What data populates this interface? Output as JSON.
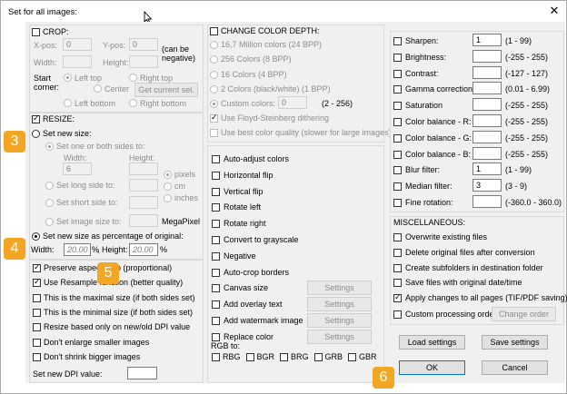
{
  "window": {
    "title": "Set for all images:",
    "close_glyph": "✕"
  },
  "crop": {
    "header": "CROP:",
    "xpos_label": "X-pos:",
    "xpos_value": "0",
    "ypos_label": "Y-pos:",
    "ypos_value": "0",
    "can_be_negative": "(can be\nnegative)",
    "width_label": "Width:",
    "width_value": "",
    "height_label": "Height:",
    "height_value": "",
    "start_corner": "Start\ncorner:",
    "left_top": "Left top",
    "right_top": "Right top",
    "center": "Center",
    "get_current_sel": "Get current sel.",
    "left_bottom": "Left bottom",
    "right_bottom": "Right bottom"
  },
  "resize": {
    "header": "RESIZE:",
    "set_new_size": "Set new size:",
    "set_one_or_both": "Set one or both sides to:",
    "width_label": "Width:",
    "height_label": "Height:",
    "width_value": "6",
    "height_value": "",
    "pixels": "pixels",
    "cm": "cm",
    "inches": "inches",
    "long_side": "Set long side to:",
    "short_side": "Set short side to:",
    "image_size": "Set image size to:",
    "megapixel": "MegaPixel",
    "percentage": "Set new size as percentage of original:",
    "pct_width_label": "Width:",
    "pct_width_value": "20.00",
    "pct_symbol": "%",
    "pct_height_label": ", Height:",
    "pct_height_value": "20.00"
  },
  "options_left": [
    {
      "label": "Preserve aspect ratio (proportional)",
      "checked": true
    },
    {
      "label": "Use Resample function (better quality)",
      "checked": true
    },
    {
      "label": "This is the maximal size (if both sides set)",
      "checked": false
    },
    {
      "label": "This is the minimal size (if both sides set)",
      "checked": false
    },
    {
      "label": "Resize based only on new/old DPI value",
      "checked": false
    },
    {
      "label": "Don't enlarge smaller images",
      "checked": false
    },
    {
      "label": "Don't shrink bigger images",
      "checked": false
    }
  ],
  "dpi": {
    "label": "Set new DPI value:",
    "value": ""
  },
  "color_depth": {
    "header": "CHANGE COLOR DEPTH:",
    "options": [
      "16,7 Million colors (24 BPP)",
      "256 Colors (8 BPP)",
      "16 Colors (4 BPP)",
      "2 Colors (black/white) (1 BPP)"
    ],
    "custom_label": "Custom colors:",
    "custom_value": "0",
    "custom_range": "(2 - 256)",
    "floyd": "Use Floyd-Steinberg dithering",
    "best_quality": "Use best color quality (slower for large images)"
  },
  "transforms": [
    {
      "label": "Auto-adjust colors",
      "settings": false
    },
    {
      "label": "Horizontal flip",
      "settings": false
    },
    {
      "label": "Vertical flip",
      "settings": false
    },
    {
      "label": "Rotate left",
      "settings": false
    },
    {
      "label": "Rotate right",
      "settings": false
    },
    {
      "label": "Convert to grayscale",
      "settings": false
    },
    {
      "label": "Negative",
      "settings": false
    },
    {
      "label": "Auto-crop borders",
      "settings": false
    },
    {
      "label": "Canvas size",
      "settings": true
    },
    {
      "label": "Add overlay text",
      "settings": true
    },
    {
      "label": "Add watermark image",
      "settings": true
    },
    {
      "label": "Replace color",
      "settings": true
    }
  ],
  "settings_label": "Settings",
  "rgb": {
    "label": "RGB to:",
    "options": [
      "RBG",
      "BGR",
      "BRG",
      "GRB",
      "GBR"
    ]
  },
  "adjustments": [
    {
      "label": "Sharpen:",
      "value": "1",
      "range": "(1 - 99)"
    },
    {
      "label": "Brightness:",
      "value": "",
      "range": "(-255 - 255)"
    },
    {
      "label": "Contrast:",
      "value": "",
      "range": "(-127 - 127)"
    },
    {
      "label": "Gamma correction:",
      "value": "",
      "range": "(0.01 - 6.99)"
    },
    {
      "label": "Saturation",
      "value": "",
      "range": "(-255 - 255)"
    },
    {
      "label": "Color balance - R:",
      "value": "",
      "range": "(-255 - 255)"
    },
    {
      "label": "Color balance - G:",
      "value": "",
      "range": "(-255 - 255)"
    },
    {
      "label": "Color balance - B:",
      "value": "",
      "range": "(-255 - 255)"
    },
    {
      "label": "Blur filter:",
      "value": "1",
      "range": "(1 - 99)"
    },
    {
      "label": "Median filter:",
      "value": "3",
      "range": "(3 - 9)"
    },
    {
      "label": "Fine rotation:",
      "value": "",
      "range": "(-360.0 - 360.0)"
    }
  ],
  "misc": {
    "header": "MISCELLANEOUS:",
    "options": [
      {
        "label": "Overwrite existing files",
        "checked": false
      },
      {
        "label": "Delete original files after conversion",
        "checked": false
      },
      {
        "label": "Create subfolders in destination folder",
        "checked": false
      },
      {
        "label": "Save files with original date/time",
        "checked": false
      },
      {
        "label": "Apply changes to all pages (TIF/PDF saving)",
        "checked": true
      }
    ],
    "custom_order": "Custom processing order",
    "change_order": "Change order"
  },
  "buttons": {
    "load": "Load settings",
    "save": "Save settings",
    "ok": "OK",
    "cancel": "Cancel"
  },
  "badges": [
    "3",
    "4",
    "5",
    "6"
  ],
  "colors": {
    "badge": "#f2a623",
    "focus": "#0078d7"
  }
}
